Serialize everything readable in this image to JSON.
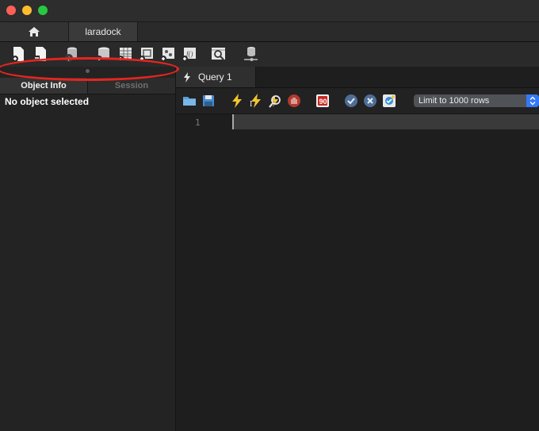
{
  "window": {
    "traffic_lights": {
      "close": "#fe5f57",
      "minimize": "#febc2e",
      "maximize": "#28c840"
    }
  },
  "connection_tabs": {
    "home_icon": "home-icon",
    "active_connection": "laradock"
  },
  "toolbar": {
    "icons": [
      "new-sql-tab-icon",
      "open-sql-script-icon",
      "inspector-icon",
      "create-schema-icon",
      "create-table-icon",
      "create-view-icon",
      "create-procedure-icon",
      "create-function-icon",
      "search-table-data-icon",
      "reconnect-icon"
    ]
  },
  "left_panel": {
    "tabs": [
      {
        "label": "Object Info",
        "active": true
      },
      {
        "label": "Session",
        "active": false
      }
    ],
    "content": "No object selected"
  },
  "annotation": {
    "color": "#e5251f",
    "shape": "ellipse"
  },
  "query_tabs": [
    {
      "label": "Query 1",
      "icon": "lightning-icon"
    }
  ],
  "query_toolbar": {
    "icons": [
      "open-file-icon",
      "save-icon",
      "execute-icon",
      "execute-current-icon",
      "explain-icon",
      "stop-icon",
      "toggle-error-icon",
      "commit-icon",
      "rollback-icon",
      "autocommit-icon"
    ],
    "limit_select": {
      "value": "Limit to 1000 rows"
    }
  },
  "editor": {
    "line_numbers": [
      "1"
    ]
  }
}
